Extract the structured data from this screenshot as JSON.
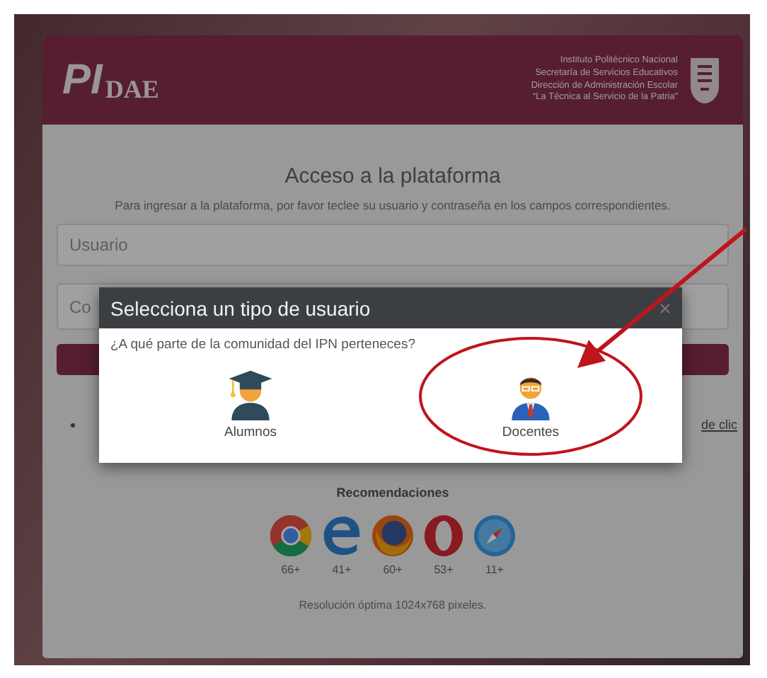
{
  "header": {
    "logo": {
      "main": "PI",
      "sub": "DAE"
    },
    "institution_lines": [
      "Instituto Politécnico Nacional",
      "Secretaría de Servicios Educativos",
      "Dirección de Administración Escolar",
      "“La Técnica al Servicio de la Patria”"
    ]
  },
  "login": {
    "title": "Acceso a la plataforma",
    "description": "Para ingresar a la plataforma, por favor teclee su usuario y contraseña en los campos correspondientes.",
    "username_field": {
      "placeholder": "Usuario"
    },
    "password_field": {
      "placeholder": "Co"
    },
    "notes": [
      "de clic"
    ]
  },
  "recommendations": {
    "title": "Recomendaciones",
    "browsers": [
      {
        "kind": "chrome",
        "version": "66+"
      },
      {
        "kind": "edge",
        "version": "41+"
      },
      {
        "kind": "firefox",
        "version": "60+"
      },
      {
        "kind": "opera",
        "version": "53+"
      },
      {
        "kind": "safari",
        "version": "11+"
      }
    ],
    "resolution": "Resolución óptima 1024x768 pixeles."
  },
  "modal": {
    "title": "Selecciona un tipo de usuario",
    "question": "¿A qué parte de la comunidad del IPN perteneces?",
    "options": [
      {
        "kind": "student",
        "label": "Alumnos",
        "circled": false
      },
      {
        "kind": "teacher",
        "label": "Docentes",
        "circled": true
      }
    ]
  }
}
